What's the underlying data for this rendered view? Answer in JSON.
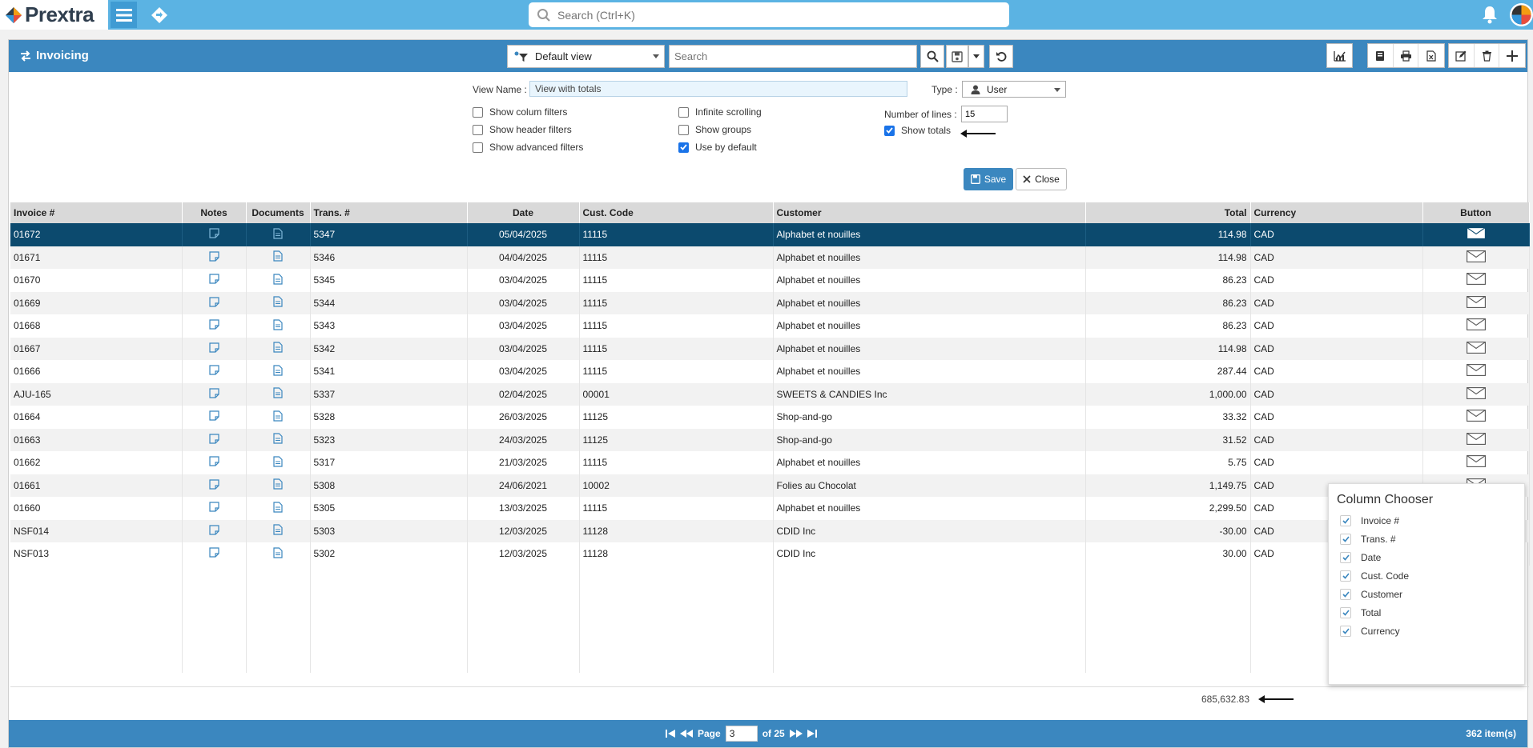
{
  "app": {
    "brand": "Prextra",
    "search_placeholder": "Search (Ctrl+K)"
  },
  "panel": {
    "title": "Invoicing",
    "view_select": "Default view",
    "search_placeholder": "Search"
  },
  "settings": {
    "view_name_label": "View Name :",
    "view_name_value": "View with totals",
    "type_label": "Type :",
    "type_value": "User",
    "show_column_filters": "Show colum filters",
    "show_header_filters": "Show header filters",
    "show_advanced_filters": "Show advanced filters",
    "infinite_scrolling": "Infinite scrolling",
    "show_groups": "Show groups",
    "use_by_default": "Use by default",
    "number_of_lines_label": "Number of lines :",
    "number_of_lines_value": "15",
    "show_totals": "Show totals",
    "save_label": "Save",
    "close_label": "Close"
  },
  "grid": {
    "columns": [
      "Invoice #",
      "Notes",
      "Documents",
      "Trans. #",
      "Date",
      "Cust. Code",
      "Customer",
      "Total",
      "Currency",
      "Button"
    ],
    "rows": [
      {
        "invoice": "01672",
        "trans": "5347",
        "date": "05/04/2025",
        "code": "11115",
        "customer": "Alphabet et nouilles",
        "total": "114.98",
        "currency": "CAD"
      },
      {
        "invoice": "01671",
        "trans": "5346",
        "date": "04/04/2025",
        "code": "11115",
        "customer": "Alphabet et nouilles",
        "total": "114.98",
        "currency": "CAD"
      },
      {
        "invoice": "01670",
        "trans": "5345",
        "date": "03/04/2025",
        "code": "11115",
        "customer": "Alphabet et nouilles",
        "total": "86.23",
        "currency": "CAD"
      },
      {
        "invoice": "01669",
        "trans": "5344",
        "date": "03/04/2025",
        "code": "11115",
        "customer": "Alphabet et nouilles",
        "total": "86.23",
        "currency": "CAD"
      },
      {
        "invoice": "01668",
        "trans": "5343",
        "date": "03/04/2025",
        "code": "11115",
        "customer": "Alphabet et nouilles",
        "total": "86.23",
        "currency": "CAD"
      },
      {
        "invoice": "01667",
        "trans": "5342",
        "date": "03/04/2025",
        "code": "11115",
        "customer": "Alphabet et nouilles",
        "total": "114.98",
        "currency": "CAD"
      },
      {
        "invoice": "01666",
        "trans": "5341",
        "date": "03/04/2025",
        "code": "11115",
        "customer": "Alphabet et nouilles",
        "total": "287.44",
        "currency": "CAD"
      },
      {
        "invoice": "AJU-165",
        "trans": "5337",
        "date": "02/04/2025",
        "code": "00001",
        "customer": "SWEETS & CANDIES Inc",
        "total": "1,000.00",
        "currency": "CAD"
      },
      {
        "invoice": "01664",
        "trans": "5328",
        "date": "26/03/2025",
        "code": "11125",
        "customer": "Shop-and-go",
        "total": "33.32",
        "currency": "CAD"
      },
      {
        "invoice": "01663",
        "trans": "5323",
        "date": "24/03/2025",
        "code": "11125",
        "customer": "Shop-and-go",
        "total": "31.52",
        "currency": "CAD"
      },
      {
        "invoice": "01662",
        "trans": "5317",
        "date": "21/03/2025",
        "code": "11115",
        "customer": "Alphabet et nouilles",
        "total": "5.75",
        "currency": "CAD"
      },
      {
        "invoice": "01661",
        "trans": "5308",
        "date": "24/06/2021",
        "code": "10002",
        "customer": "Folies au Chocolat",
        "total": "1,149.75",
        "currency": "CAD"
      },
      {
        "invoice": "01660",
        "trans": "5305",
        "date": "13/03/2025",
        "code": "11115",
        "customer": "Alphabet et nouilles",
        "total": "2,299.50",
        "currency": "CAD"
      },
      {
        "invoice": "NSF014",
        "trans": "5303",
        "date": "12/03/2025",
        "code": "11128",
        "customer": "CDID Inc",
        "total": "-30.00",
        "currency": "CAD"
      },
      {
        "invoice": "NSF013",
        "trans": "5302",
        "date": "12/03/2025",
        "code": "11128",
        "customer": "CDID Inc",
        "total": "30.00",
        "currency": "CAD"
      }
    ],
    "grand_total": "685,632.83"
  },
  "footer": {
    "page_label": "Page",
    "page_value": "3",
    "of_label": "of 25",
    "items_label": "362 item(s)"
  },
  "chooser": {
    "title": "Column Chooser",
    "items": [
      "Invoice #",
      "Trans. #",
      "Date",
      "Cust. Code",
      "Customer",
      "Total",
      "Currency"
    ]
  },
  "colors": {
    "header_blue": "#3b87bf",
    "top_blue": "#5bb3e3",
    "selected_row": "#0c4a6e"
  }
}
